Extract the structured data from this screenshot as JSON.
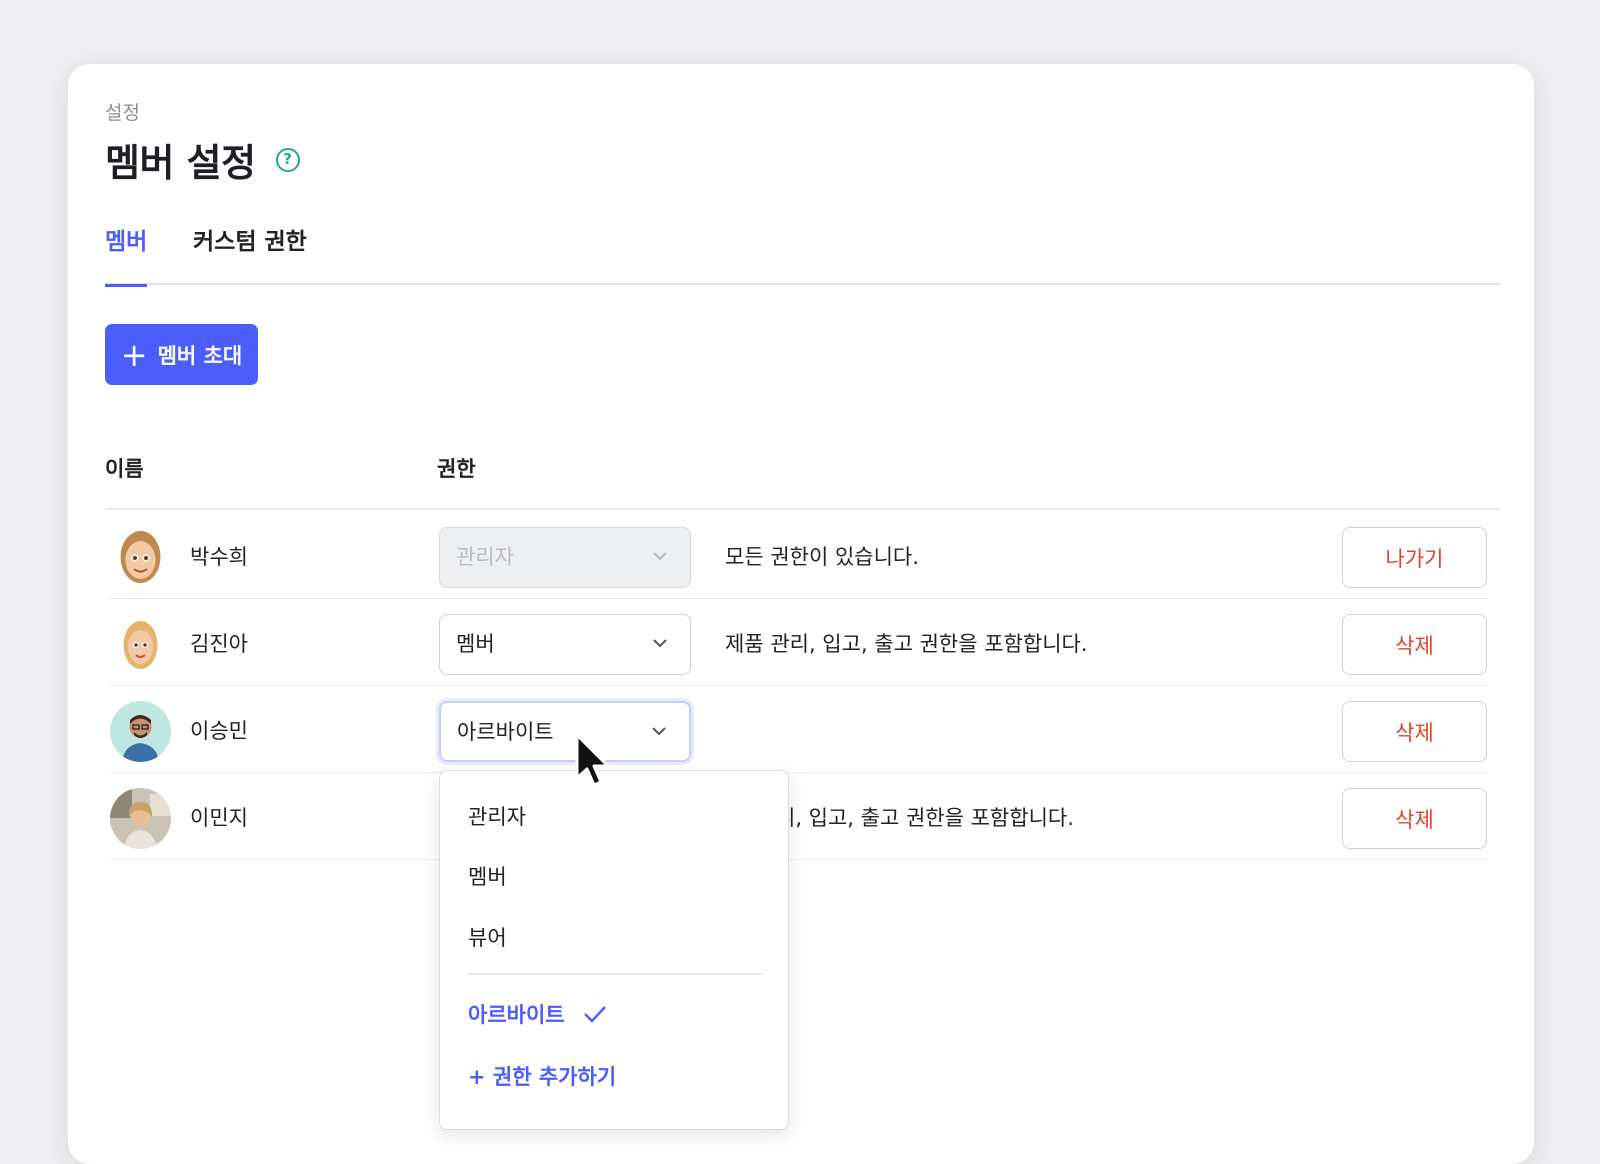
{
  "breadcrumb": "설정",
  "page_title": "멤버 설정",
  "help_icon": "question-circle-icon",
  "tabs": [
    {
      "label": "멤버",
      "active": true
    },
    {
      "label": "커스텀 권한",
      "active": false
    }
  ],
  "invite_button": {
    "label": "멤버 초대",
    "icon": "plus-icon"
  },
  "columns": {
    "name": "이름",
    "role": "권한"
  },
  "members": [
    {
      "name": "박수희",
      "role": "관리자",
      "description": "모든 권한이 있습니다.",
      "action": "나가기",
      "disabled": true
    },
    {
      "name": "김진아",
      "role": "멤버",
      "description": "제품 관리, 입고, 출고 권한을 포함합니다.",
      "action": "삭제"
    },
    {
      "name": "이승민",
      "role": "아르바이트",
      "description": "",
      "action": "삭제",
      "focused": true
    },
    {
      "name": "이민지",
      "role": "",
      "description": "제품 관리, 입고, 출고 권한을 포함합니다.",
      "description_visible": "리, 입고, 출고 권한을 포함합니다.",
      "action": "삭제"
    }
  ],
  "role_dropdown": {
    "options": [
      "관리자",
      "멤버",
      "뷰어"
    ],
    "selected": "아르바이트",
    "add_label": "+ 권한 추가하기"
  },
  "colors": {
    "accent": "#4b5dfb",
    "danger": "#e8402e",
    "help": "#27a787"
  }
}
